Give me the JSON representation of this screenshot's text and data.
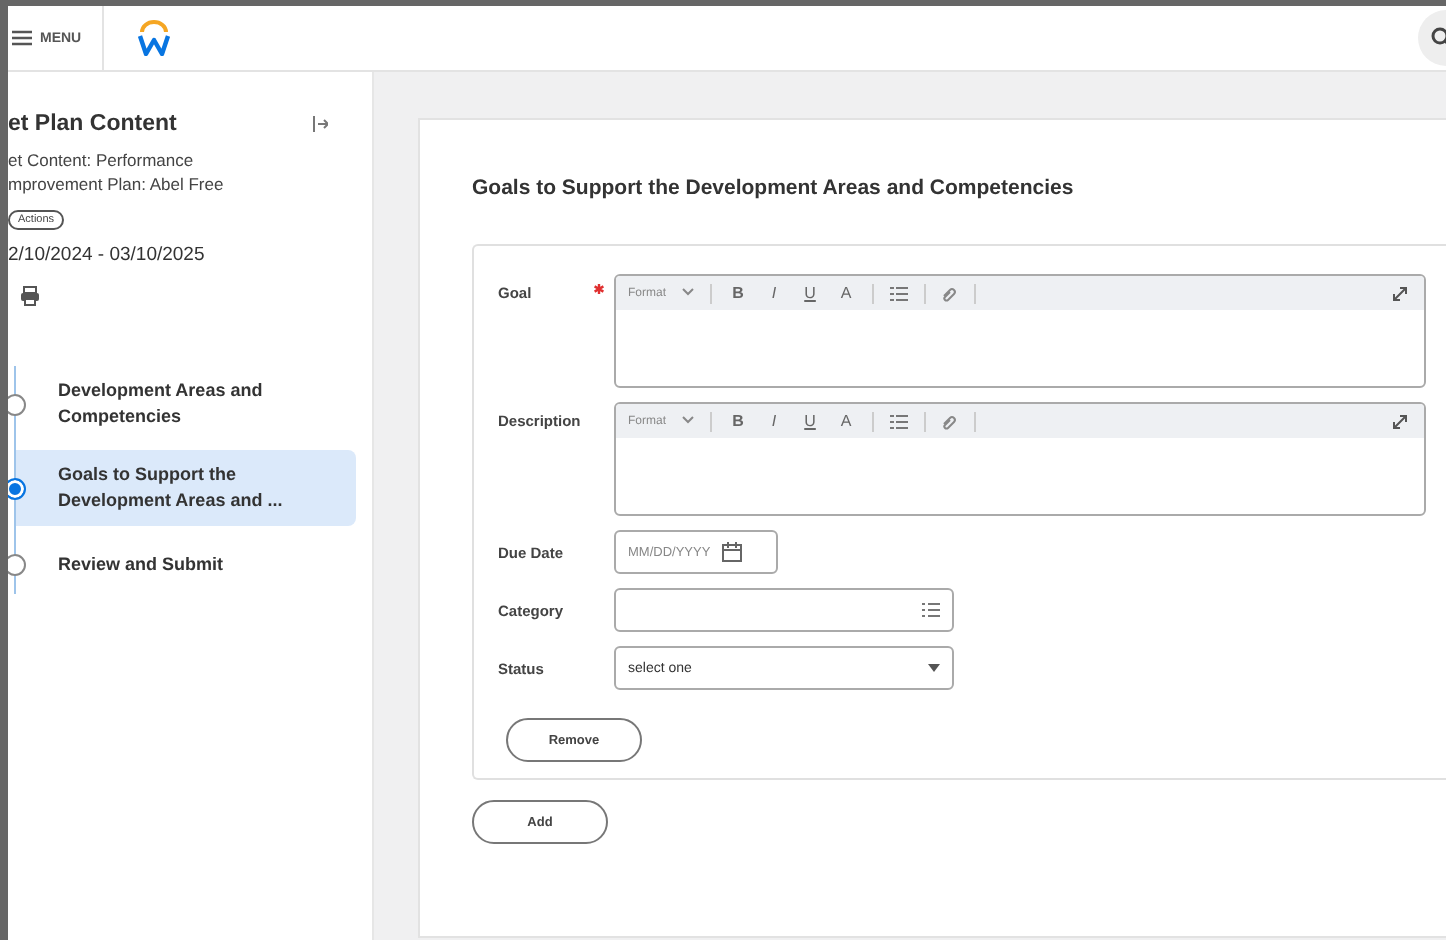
{
  "top_bar": {
    "menu_label": "MENU"
  },
  "sidebar": {
    "title": "et Plan Content",
    "subtitle": "et Content: Performance mprovement Plan: Abel Free",
    "actions_label": "Actions",
    "date_range": "2/10/2024 - 03/10/2025",
    "steps": [
      {
        "label": "Development Areas and Competencies",
        "selected": false
      },
      {
        "label": "Goals to Support the Development Areas and ...",
        "selected": true
      },
      {
        "label": "Review and Submit",
        "selected": false
      }
    ]
  },
  "main": {
    "title": "Goals to Support the Development Areas and Competencies",
    "editors": [
      {
        "label": "Goal",
        "required": true,
        "format": "Format",
        "tools": [
          "B",
          "I",
          "U",
          "A"
        ]
      },
      {
        "label": "Description",
        "required": false,
        "format": "Format",
        "tools": [
          "B",
          "I",
          "U",
          "A"
        ]
      }
    ],
    "due_date": {
      "label": "Due Date",
      "placeholder": "MM/DD/YYYY"
    },
    "category": {
      "label": "Category"
    },
    "status": {
      "label": "Status",
      "value": "select one"
    },
    "remove_button": "Remove",
    "add_button": "Add"
  }
}
